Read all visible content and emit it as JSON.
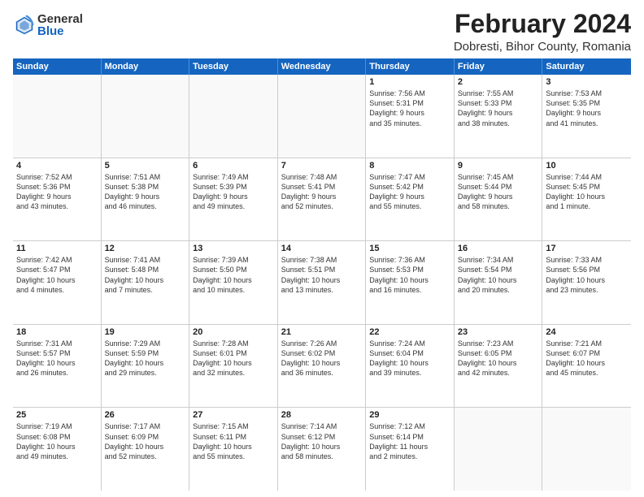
{
  "logo": {
    "general": "General",
    "blue": "Blue"
  },
  "title": "February 2024",
  "subtitle": "Dobresti, Bihor County, Romania",
  "header_days": [
    "Sunday",
    "Monday",
    "Tuesday",
    "Wednesday",
    "Thursday",
    "Friday",
    "Saturday"
  ],
  "weeks": [
    [
      {
        "day": "",
        "info": ""
      },
      {
        "day": "",
        "info": ""
      },
      {
        "day": "",
        "info": ""
      },
      {
        "day": "",
        "info": ""
      },
      {
        "day": "1",
        "info": "Sunrise: 7:56 AM\nSunset: 5:31 PM\nDaylight: 9 hours\nand 35 minutes."
      },
      {
        "day": "2",
        "info": "Sunrise: 7:55 AM\nSunset: 5:33 PM\nDaylight: 9 hours\nand 38 minutes."
      },
      {
        "day": "3",
        "info": "Sunrise: 7:53 AM\nSunset: 5:35 PM\nDaylight: 9 hours\nand 41 minutes."
      }
    ],
    [
      {
        "day": "4",
        "info": "Sunrise: 7:52 AM\nSunset: 5:36 PM\nDaylight: 9 hours\nand 43 minutes."
      },
      {
        "day": "5",
        "info": "Sunrise: 7:51 AM\nSunset: 5:38 PM\nDaylight: 9 hours\nand 46 minutes."
      },
      {
        "day": "6",
        "info": "Sunrise: 7:49 AM\nSunset: 5:39 PM\nDaylight: 9 hours\nand 49 minutes."
      },
      {
        "day": "7",
        "info": "Sunrise: 7:48 AM\nSunset: 5:41 PM\nDaylight: 9 hours\nand 52 minutes."
      },
      {
        "day": "8",
        "info": "Sunrise: 7:47 AM\nSunset: 5:42 PM\nDaylight: 9 hours\nand 55 minutes."
      },
      {
        "day": "9",
        "info": "Sunrise: 7:45 AM\nSunset: 5:44 PM\nDaylight: 9 hours\nand 58 minutes."
      },
      {
        "day": "10",
        "info": "Sunrise: 7:44 AM\nSunset: 5:45 PM\nDaylight: 10 hours\nand 1 minute."
      }
    ],
    [
      {
        "day": "11",
        "info": "Sunrise: 7:42 AM\nSunset: 5:47 PM\nDaylight: 10 hours\nand 4 minutes."
      },
      {
        "day": "12",
        "info": "Sunrise: 7:41 AM\nSunset: 5:48 PM\nDaylight: 10 hours\nand 7 minutes."
      },
      {
        "day": "13",
        "info": "Sunrise: 7:39 AM\nSunset: 5:50 PM\nDaylight: 10 hours\nand 10 minutes."
      },
      {
        "day": "14",
        "info": "Sunrise: 7:38 AM\nSunset: 5:51 PM\nDaylight: 10 hours\nand 13 minutes."
      },
      {
        "day": "15",
        "info": "Sunrise: 7:36 AM\nSunset: 5:53 PM\nDaylight: 10 hours\nand 16 minutes."
      },
      {
        "day": "16",
        "info": "Sunrise: 7:34 AM\nSunset: 5:54 PM\nDaylight: 10 hours\nand 20 minutes."
      },
      {
        "day": "17",
        "info": "Sunrise: 7:33 AM\nSunset: 5:56 PM\nDaylight: 10 hours\nand 23 minutes."
      }
    ],
    [
      {
        "day": "18",
        "info": "Sunrise: 7:31 AM\nSunset: 5:57 PM\nDaylight: 10 hours\nand 26 minutes."
      },
      {
        "day": "19",
        "info": "Sunrise: 7:29 AM\nSunset: 5:59 PM\nDaylight: 10 hours\nand 29 minutes."
      },
      {
        "day": "20",
        "info": "Sunrise: 7:28 AM\nSunset: 6:01 PM\nDaylight: 10 hours\nand 32 minutes."
      },
      {
        "day": "21",
        "info": "Sunrise: 7:26 AM\nSunset: 6:02 PM\nDaylight: 10 hours\nand 36 minutes."
      },
      {
        "day": "22",
        "info": "Sunrise: 7:24 AM\nSunset: 6:04 PM\nDaylight: 10 hours\nand 39 minutes."
      },
      {
        "day": "23",
        "info": "Sunrise: 7:23 AM\nSunset: 6:05 PM\nDaylight: 10 hours\nand 42 minutes."
      },
      {
        "day": "24",
        "info": "Sunrise: 7:21 AM\nSunset: 6:07 PM\nDaylight: 10 hours\nand 45 minutes."
      }
    ],
    [
      {
        "day": "25",
        "info": "Sunrise: 7:19 AM\nSunset: 6:08 PM\nDaylight: 10 hours\nand 49 minutes."
      },
      {
        "day": "26",
        "info": "Sunrise: 7:17 AM\nSunset: 6:09 PM\nDaylight: 10 hours\nand 52 minutes."
      },
      {
        "day": "27",
        "info": "Sunrise: 7:15 AM\nSunset: 6:11 PM\nDaylight: 10 hours\nand 55 minutes."
      },
      {
        "day": "28",
        "info": "Sunrise: 7:14 AM\nSunset: 6:12 PM\nDaylight: 10 hours\nand 58 minutes."
      },
      {
        "day": "29",
        "info": "Sunrise: 7:12 AM\nSunset: 6:14 PM\nDaylight: 11 hours\nand 2 minutes."
      },
      {
        "day": "",
        "info": ""
      },
      {
        "day": "",
        "info": ""
      }
    ]
  ]
}
